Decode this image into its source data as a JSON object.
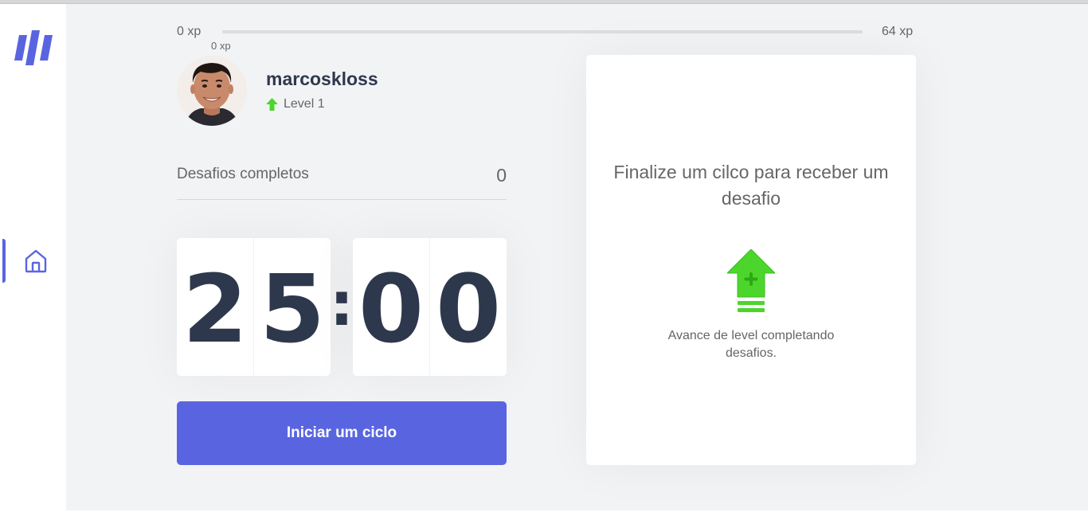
{
  "colors": {
    "accent": "#5965e0",
    "green": "#4cd62b",
    "text_dark": "#2e384d",
    "text": "#666666",
    "background": "#f2f3f5"
  },
  "sidebar": {
    "logo_icon": "moveit-logo-icon",
    "items": [
      {
        "icon": "home-icon",
        "active": true
      }
    ]
  },
  "xp_bar": {
    "min_label": "0 xp",
    "max_label": "64 xp",
    "current_label": "0 xp",
    "progress_fraction": 0
  },
  "profile": {
    "username": "marcoskloss",
    "level_label": "Level 1",
    "level_icon": "level-up-arrow-icon"
  },
  "completed_challenges": {
    "label": "Desafios completos",
    "count": "0"
  },
  "countdown": {
    "minute_left": "2",
    "minute_right": "5",
    "separator": ":",
    "second_left": "0",
    "second_right": "0"
  },
  "start_button": {
    "label": "Iniciar um ciclo"
  },
  "challenge_box": {
    "title": "Finalize um cilco para receber um desafio",
    "icon": "level-up-icon",
    "hint": "Avance de level completando desafios."
  }
}
